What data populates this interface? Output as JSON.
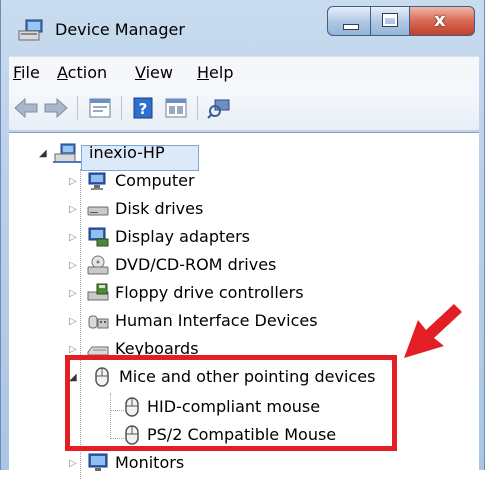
{
  "window": {
    "title": "Device Manager",
    "caption_buttons": {
      "minimize": "minimize",
      "maximize": "maximize",
      "close": "x"
    }
  },
  "menu": [
    {
      "label": "File",
      "mnemonic": "F",
      "rest": "ile"
    },
    {
      "label": "Action",
      "mnemonic": "A",
      "rest": "ction"
    },
    {
      "label": "View",
      "mnemonic": "V",
      "rest": "iew"
    },
    {
      "label": "Help",
      "mnemonic": "H",
      "rest": "elp"
    }
  ],
  "toolbar": {
    "buttons": [
      "back-arrow-icon",
      "forward-arrow-icon",
      "properties-icon",
      "help-icon",
      "view-icon",
      "scan-hardware-icon"
    ]
  },
  "tree": {
    "root": {
      "label": "inexio-HP",
      "icon": "computer-network-icon",
      "expanded": true
    },
    "categories": [
      {
        "label": "Computer",
        "icon": "computer-icon",
        "expanded": false
      },
      {
        "label": "Disk drives",
        "icon": "disk-drive-icon",
        "expanded": false
      },
      {
        "label": "Display adapters",
        "icon": "display-adapter-icon",
        "expanded": false
      },
      {
        "label": "DVD/CD-ROM drives",
        "icon": "dvd-drive-icon",
        "expanded": false
      },
      {
        "label": "Floppy drive controllers",
        "icon": "floppy-controller-icon",
        "expanded": false
      },
      {
        "label": "Human Interface Devices",
        "icon": "hid-icon",
        "expanded": false
      },
      {
        "label": "Keyboards",
        "icon": "keyboard-icon",
        "expanded": false
      },
      {
        "label": "Mice and other pointing devices",
        "icon": "mouse-icon",
        "expanded": true,
        "children": [
          {
            "label": "HID-compliant mouse",
            "icon": "mouse-icon"
          },
          {
            "label": "PS/2 Compatible Mouse",
            "icon": "mouse-icon"
          }
        ]
      },
      {
        "label": "Monitors",
        "icon": "monitor-icon",
        "expanded": false
      }
    ]
  },
  "annotation": {
    "highlight_color": "#e31e24"
  }
}
